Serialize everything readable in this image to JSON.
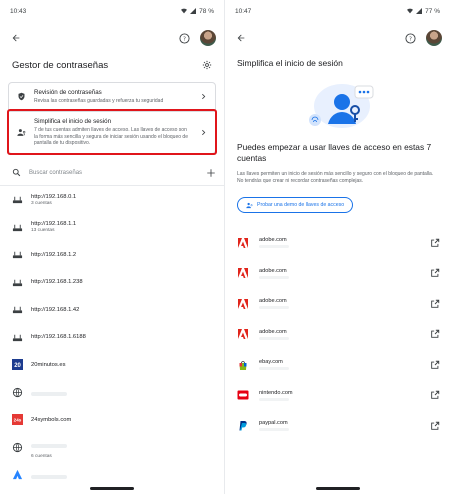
{
  "left": {
    "status": {
      "time": "10:43",
      "battery": "78 %"
    },
    "title": "Gestor de contraseñas",
    "cards": [
      {
        "title": "Revisión de contraseñas",
        "subtitle": "Revisa las contraseñas guardadas y refuerza tu seguridad"
      },
      {
        "title": "Simplifica el inicio de sesión",
        "subtitle": "7 de tus cuentas admiten llaves de acceso. Las llaves de acceso son la forma más sencilla y segura de iniciar sesión usando el bloqueo de pantalla de tu dispositivo."
      }
    ],
    "search_placeholder": "Buscar contraseñas",
    "items": [
      {
        "title": "http://192.168.0.1",
        "subtitle": "3 cuentas",
        "icon": "router-icon"
      },
      {
        "title": "http://192.168.1.1",
        "subtitle": "13 cuentas",
        "icon": "router-icon"
      },
      {
        "title": "http://192.168.1.2",
        "subtitle": "",
        "icon": "router-icon"
      },
      {
        "title": "http://192.168.1.238",
        "subtitle": "",
        "icon": "router-icon"
      },
      {
        "title": "http://192.168.1.42",
        "subtitle": "",
        "icon": "router-icon"
      },
      {
        "title": "http://192.168.1.6188",
        "subtitle": "",
        "icon": "router-icon"
      },
      {
        "title": "20minutos.es",
        "subtitle": "",
        "icon": "20minutos-logo"
      },
      {
        "title": "",
        "subtitle": "",
        "icon": "globe-icon"
      },
      {
        "title": "24symbols.com",
        "subtitle": "",
        "icon": "24symbols-logo"
      },
      {
        "title": "",
        "subtitle": "6 cuentas",
        "icon": "globe-icon"
      },
      {
        "title": "",
        "subtitle": "",
        "icon": "atlassian-logo"
      }
    ],
    "logo_text": {
      "minutos": "20",
      "symbols": "24s"
    }
  },
  "right": {
    "status": {
      "time": "10:47",
      "battery": "77 %"
    },
    "title": "Simplifica el inicio de sesión",
    "heading": "Puedes empezar a usar llaves de acceso en estas 7 cuentas",
    "body": "Las llaves permiten un inicio de sesión más sencillo y seguro con el bloqueo de pantalla. No tendrás que crear ni recordar contraseñas complejas.",
    "demo_button": "Probar una demo de llaves de acceso",
    "sites": [
      {
        "name": "adobe.com",
        "logo": "adobe-logo"
      },
      {
        "name": "adobe.com",
        "logo": "adobe-logo"
      },
      {
        "name": "adobe.com",
        "logo": "adobe-logo"
      },
      {
        "name": "adobe.com",
        "logo": "adobe-logo"
      },
      {
        "name": "ebay.com",
        "logo": "ebay-logo"
      },
      {
        "name": "nintendo.com",
        "logo": "nintendo-logo"
      },
      {
        "name": "paypal.com",
        "logo": "paypal-logo"
      }
    ]
  },
  "colors": {
    "accent": "#1a73e8",
    "highlight": "#e0151b",
    "adobe": "#e1251b"
  }
}
